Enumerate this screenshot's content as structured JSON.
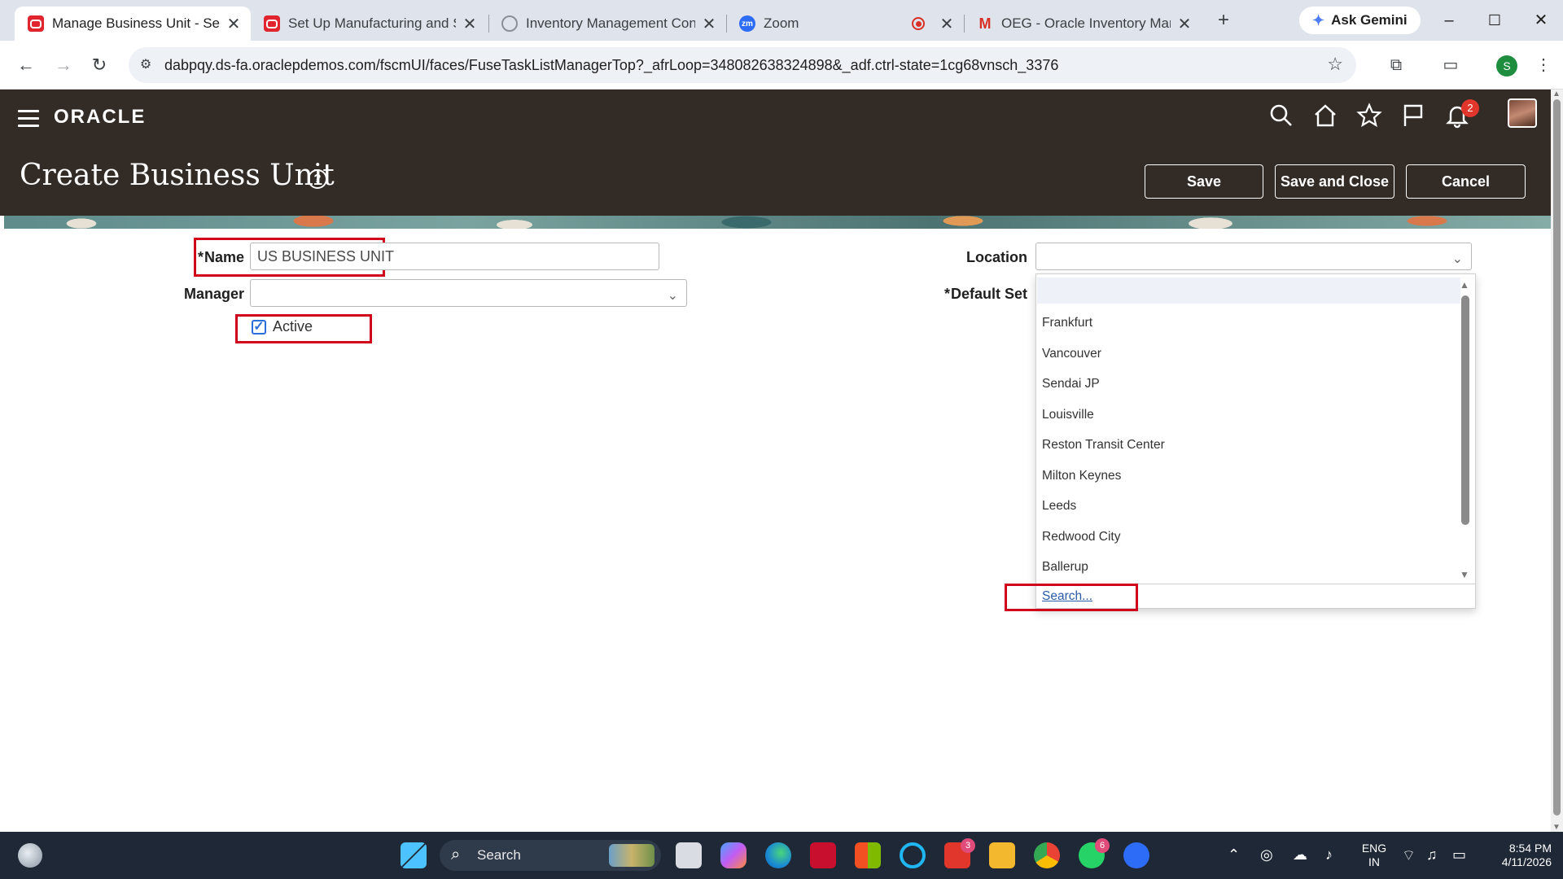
{
  "browser": {
    "tabs": [
      {
        "title": "Manage Business Unit - Setup",
        "favicon": "oracle-icon",
        "active": true
      },
      {
        "title": "Set Up Manufacturing and Sup",
        "favicon": "oracle-icon"
      },
      {
        "title": "Inventory Management Config",
        "favicon": "globe-icon"
      },
      {
        "title": "Zoom",
        "favicon": "zoom-icon"
      },
      {
        "title": "OEG - Oracle Inventory Manag",
        "favicon": "gmail-icon"
      }
    ],
    "new_tab": "+",
    "gemini_label": "Ask Gemini",
    "url": "dabpqy.ds-fa.oraclepdemos.com/fscmUI/faces/FuseTaskListManagerTop?_afrLoop=348082638324898&_adf.ctrl-state=1cg68vnsch_3376",
    "profile_initial": "S",
    "window_controls": [
      "–",
      "☐",
      "✕"
    ]
  },
  "app": {
    "logo": "ORACLE",
    "notification_count": "2",
    "page_title": "Create Business Unit",
    "help": "?",
    "buttons": {
      "save": "Save",
      "save_close": "Save and Close",
      "cancel": "Cancel"
    },
    "colors": {
      "header_bg": "#332b26",
      "highlight": "#d0021b",
      "link": "#2a5ca8"
    }
  },
  "form": {
    "name_label": "Name",
    "name_value": "US BUSINESS UNIT",
    "manager_label": "Manager",
    "manager_value": "",
    "active_label": "Active",
    "active_checked": true,
    "location_label": "Location",
    "location_value": "",
    "default_set_label": "Default Set",
    "required_marker": "*"
  },
  "location_dropdown": {
    "options": [
      "Frankfurt",
      "Vancouver",
      "Sendai JP",
      "Louisville",
      "Reston Transit Center",
      "Milton Keynes",
      "Leeds",
      "Redwood City",
      "Ballerup"
    ],
    "search_link": "Search..."
  },
  "taskbar": {
    "search_label": "Search",
    "badges": {
      "lens": "3",
      "whatsapp": "6"
    },
    "language": "ENG",
    "region": "IN",
    "time": "8:54 PM",
    "date": "4/11/2026"
  }
}
